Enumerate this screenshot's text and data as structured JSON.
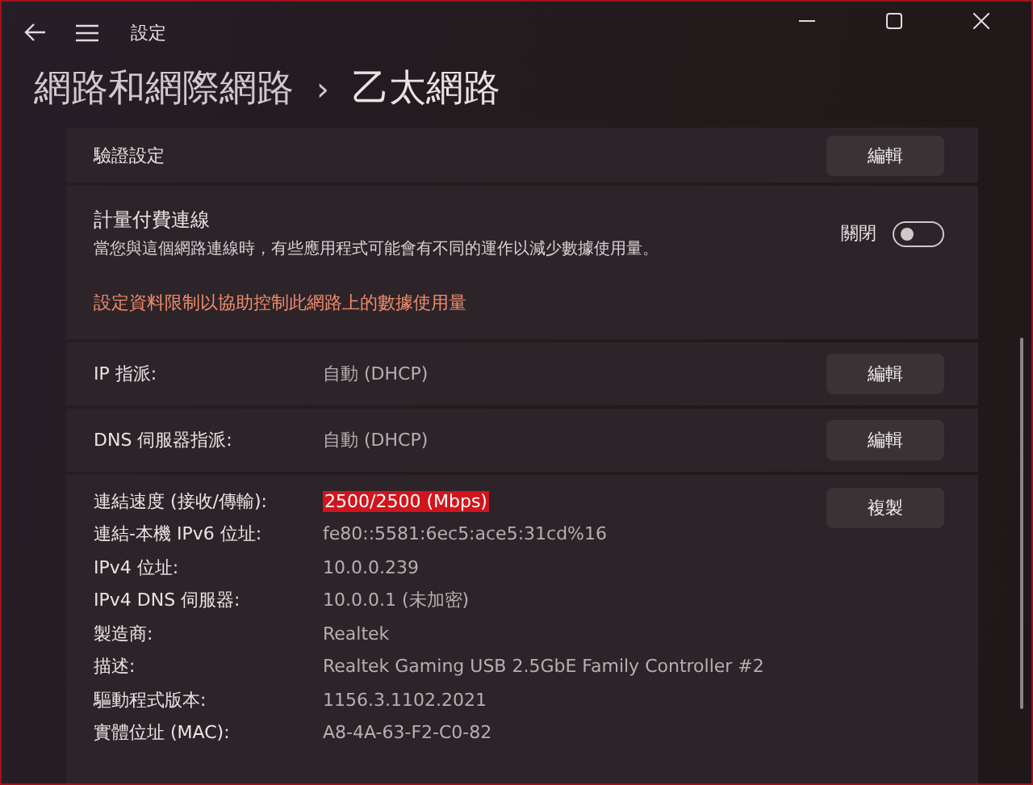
{
  "window": {
    "title": "設定"
  },
  "breadcrumb": {
    "parent": "網路和網際網路",
    "separator": "›",
    "current": "乙太網路"
  },
  "sections": [
    {
      "kind": "button_row",
      "label": "驗證設定",
      "button": "編輯"
    },
    {
      "kind": "metered",
      "title": "計量付費連線",
      "description": "當您與這個網路連線時，有些應用程式可能會有不同的運作以減少數據使用量。",
      "toggle_label": "關閉",
      "on": false,
      "link": "設定資料限制以協助控制此網路上的數據使用量"
    },
    {
      "kind": "value_row",
      "label": "IP 指派:",
      "value": "自動 (DHCP)",
      "button": "編輯"
    },
    {
      "kind": "value_row",
      "label": "DNS 伺服器指派:",
      "value": "自動 (DHCP)",
      "button": "編輯"
    },
    {
      "kind": "properties",
      "button": "複製",
      "items": [
        {
          "label": "連結速度 (接收/傳輸):",
          "value": "2500/2500 (Mbps)",
          "selected": true
        },
        {
          "label": "連結-本機 IPv6 位址:",
          "value": "fe80::5581:6ec5:ace5:31cd%16",
          "selected": false
        },
        {
          "label": "IPv4 位址:",
          "value": "10.0.0.239",
          "selected": false
        },
        {
          "label": "IPv4 DNS 伺服器:",
          "value": "10.0.0.1 (未加密)",
          "selected": false
        },
        {
          "label": "製造商:",
          "value": "Realtek",
          "selected": false
        },
        {
          "label": "描述:",
          "value": "Realtek Gaming USB 2.5GbE Family Controller #2",
          "selected": false
        },
        {
          "label": "驅動程式版本:",
          "value": "1156.3.1102.2021",
          "selected": false
        },
        {
          "label": "實體位址 (MAC):",
          "value": "A8-4A-63-F2-C0-82",
          "selected": false
        }
      ]
    }
  ]
}
